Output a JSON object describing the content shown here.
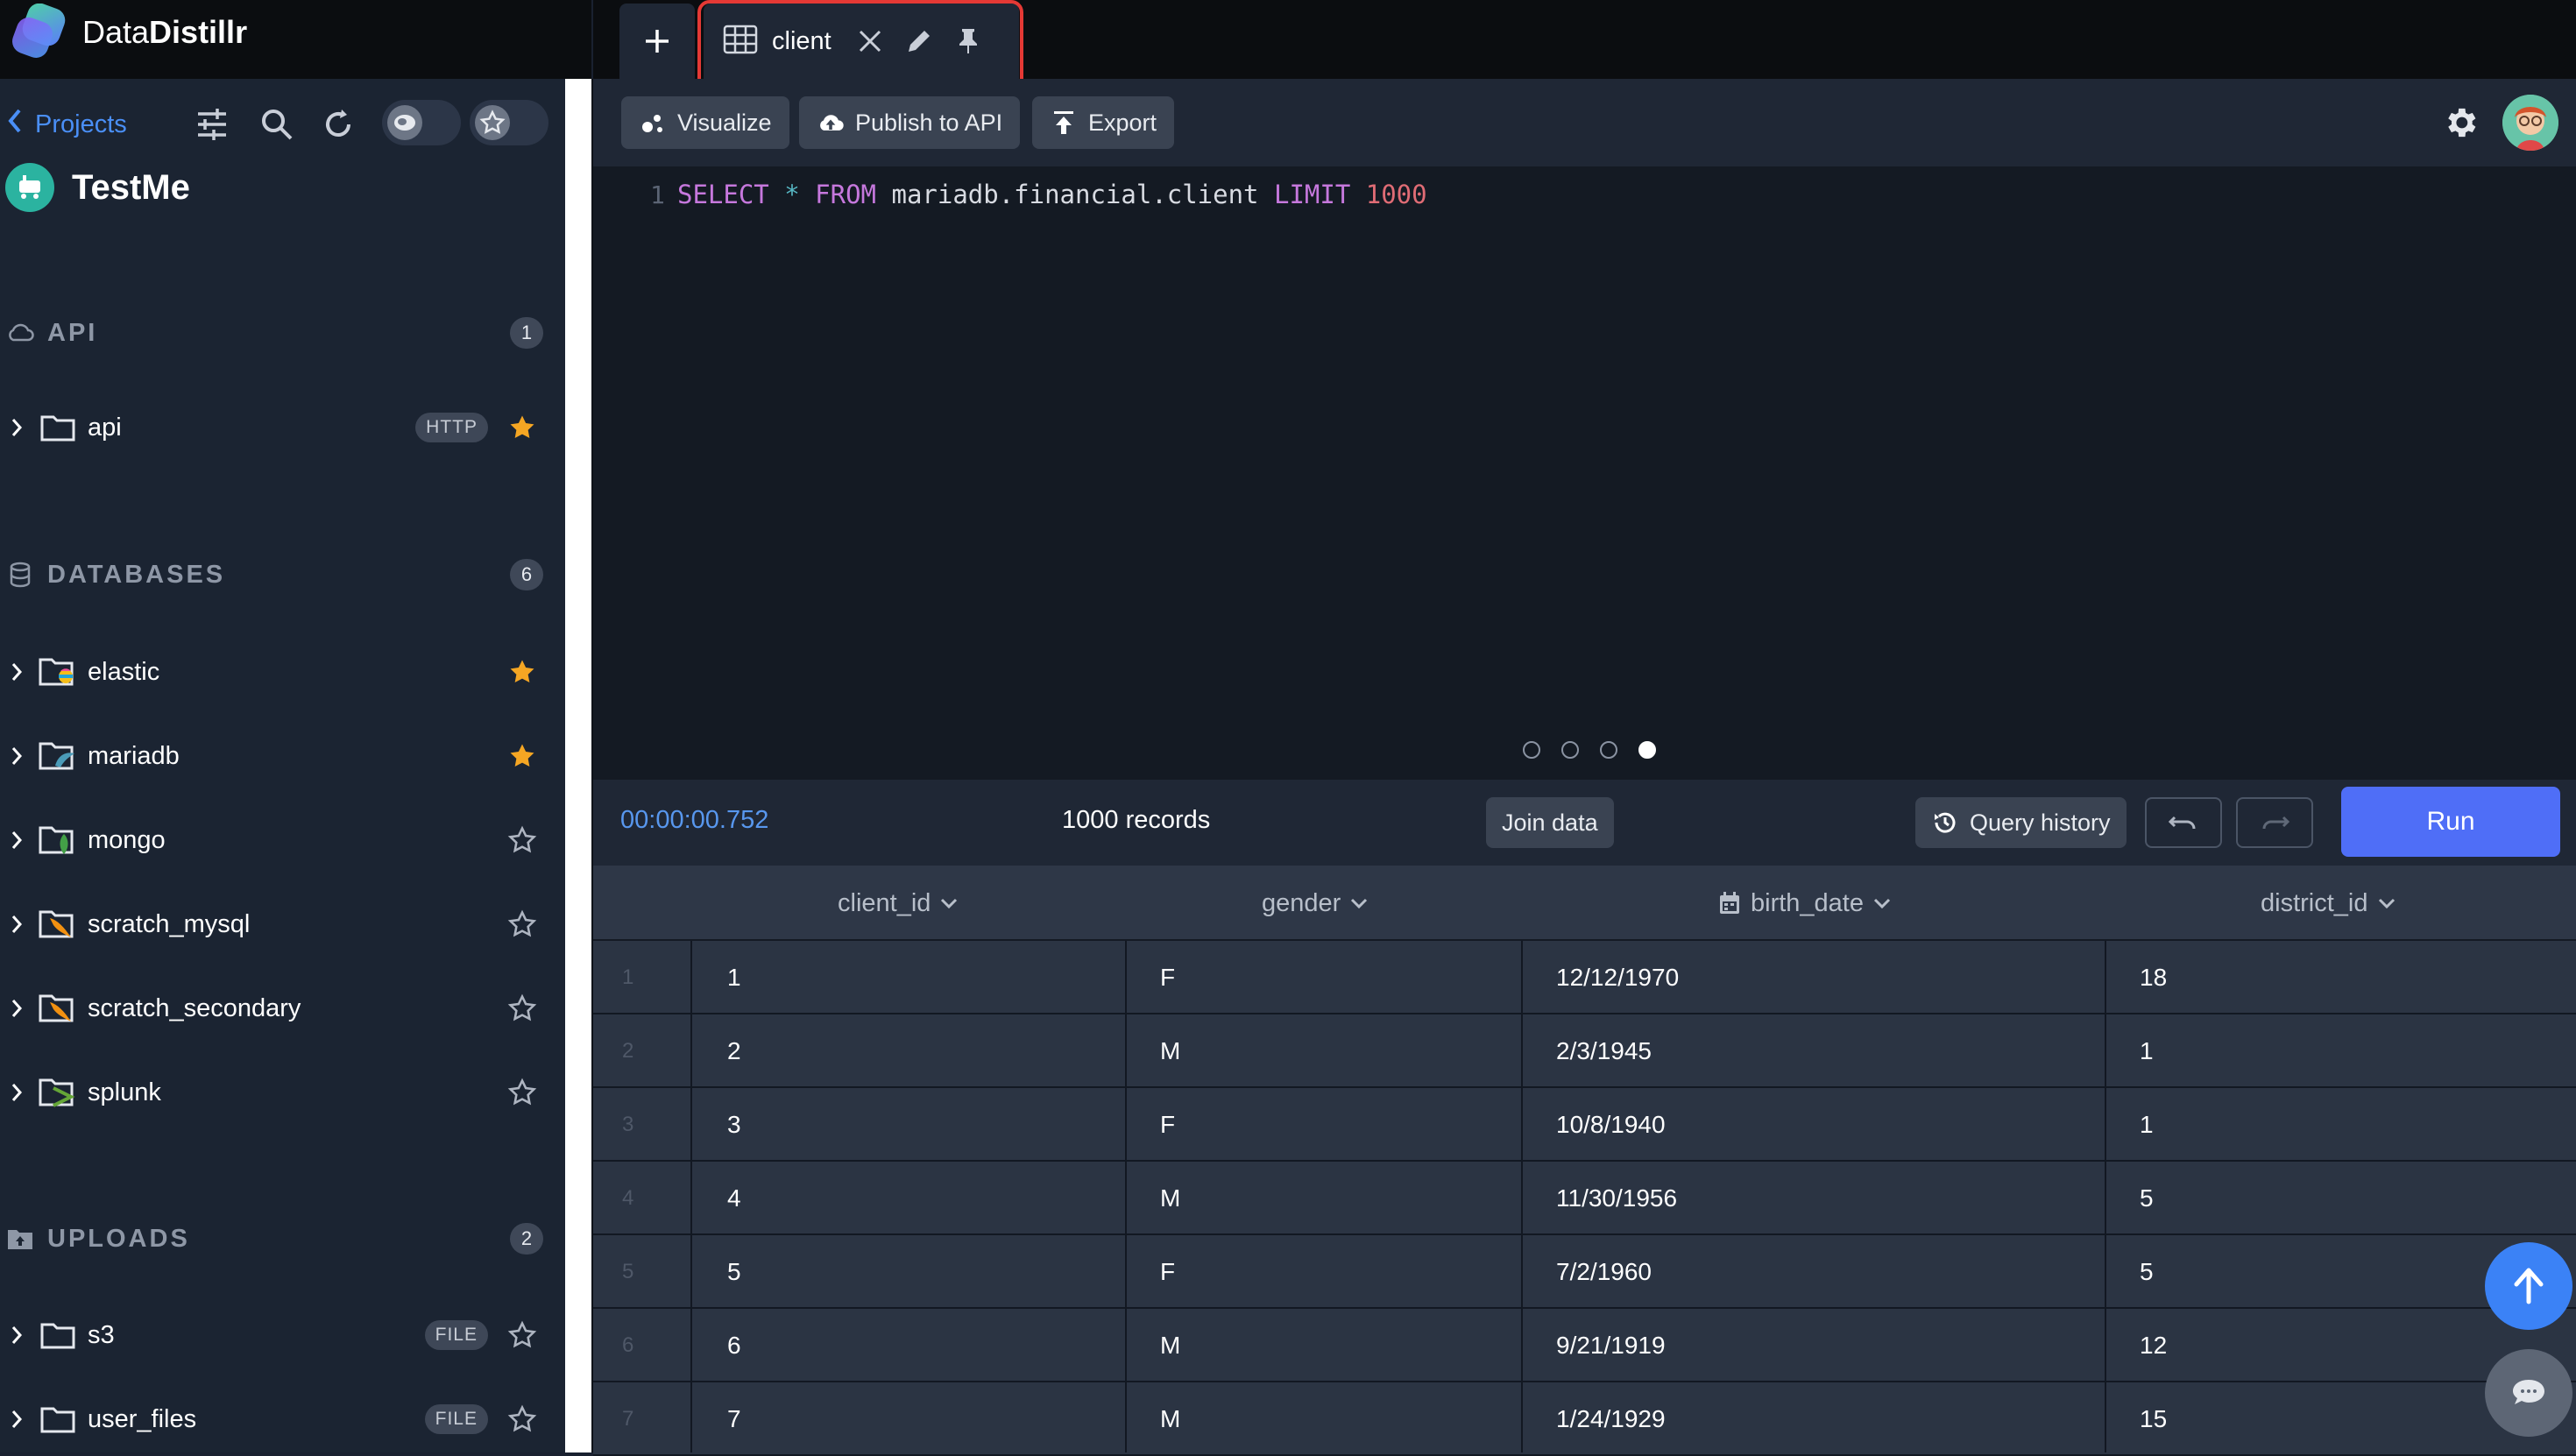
{
  "app": {
    "brand_light": "Data",
    "brand_bold": "Distillr",
    "accent": "#4f6ef7",
    "highlight": "#e53935"
  },
  "sidebar": {
    "projects_label": "Projects",
    "project_name": "TestMe",
    "sections": [
      {
        "title": "API",
        "count": "1"
      },
      {
        "title": "DATABASES",
        "count": "6"
      },
      {
        "title": "UPLOADS",
        "count": "2"
      }
    ],
    "api_items": [
      {
        "label": "api",
        "badge": "HTTP",
        "starred": true
      }
    ],
    "db_items": [
      {
        "label": "elastic",
        "starred": true
      },
      {
        "label": "mariadb",
        "starred": true
      },
      {
        "label": "mongo",
        "starred": false
      },
      {
        "label": "scratch_mysql",
        "starred": false
      },
      {
        "label": "scratch_secondary",
        "starred": false
      },
      {
        "label": "splunk",
        "starred": false
      }
    ],
    "upload_items": [
      {
        "label": "s3",
        "badge": "FILE",
        "starred": false
      },
      {
        "label": "user_files",
        "badge": "FILE",
        "starred": false
      }
    ]
  },
  "tabs": [
    {
      "label": "client",
      "icon": "table-icon"
    }
  ],
  "toolbar": {
    "visualize": "Visualize",
    "publish": "Publish to API",
    "export": "Export"
  },
  "editor": {
    "line_number": "1",
    "tokens": [
      "SELECT",
      "*",
      "FROM",
      "mariadb.financial.client",
      "LIMIT",
      "1000"
    ],
    "page_count": 4,
    "active_page": 4
  },
  "status": {
    "elapsed": "00:00:00.752",
    "records": "1000 records",
    "join_data": "Join data",
    "query_history": "Query history",
    "run": "Run"
  },
  "grid": {
    "columns": [
      "client_id",
      "gender",
      "birth_date",
      "district_id"
    ],
    "rows": [
      [
        "1",
        "1",
        "F",
        "12/12/1970",
        "18"
      ],
      [
        "2",
        "2",
        "M",
        "2/3/1945",
        "1"
      ],
      [
        "3",
        "3",
        "F",
        "10/8/1940",
        "1"
      ],
      [
        "4",
        "4",
        "M",
        "11/30/1956",
        "5"
      ],
      [
        "5",
        "5",
        "F",
        "7/2/1960",
        "5"
      ],
      [
        "6",
        "6",
        "M",
        "9/21/1919",
        "12"
      ],
      [
        "7",
        "7",
        "M",
        "1/24/1929",
        "15"
      ]
    ]
  }
}
